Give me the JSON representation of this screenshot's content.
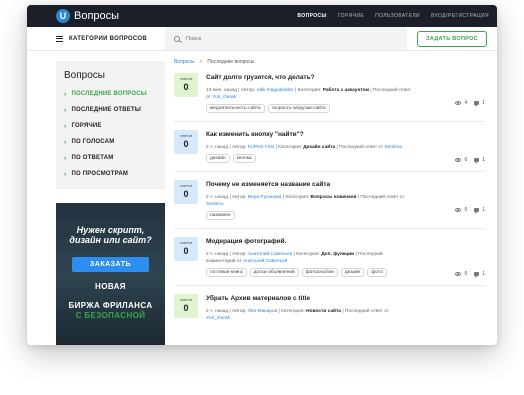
{
  "site": {
    "logo_letter": "U",
    "title": "Вопросы"
  },
  "topnav": [
    "ВОПРОСЫ",
    "ГОРЯЧИЕ",
    "ПОЛЬЗОВАТЕЛИ",
    "ВХОД/РЕГИСТРАЦИЯ"
  ],
  "subbar": {
    "categories_label": "КАТЕГОРИИ ВОПРОСОВ",
    "search_placeholder": "Поиск",
    "ask_button": "ЗАДАТЬ ВОПРОС"
  },
  "sidebar": {
    "title": "Вопросы",
    "items": [
      "ПОСЛЕДНИЕ ВОПРОСЫ",
      "ПОСЛЕДНИЕ ОТВЕТЫ",
      "ГОРЯЧИЕ",
      "ПО ГОЛОСАМ",
      "ПО ОТВЕТАМ",
      "ПО ПРОСМОТРАМ"
    ]
  },
  "ad": {
    "line1": "Нужен скрипт,",
    "line1b": "дизайн или сайт?",
    "button": "ЗАКАЗАТЬ",
    "line2": "НОВАЯ",
    "line2b": "БИРЖА ФРИЛАНСА",
    "line3": "С БЕЗОПАСНОЙ"
  },
  "breadcrumb": {
    "home": "Вопросы",
    "separator": ">",
    "current": "Последние вопросы"
  },
  "answers_caption": "ответов",
  "questions": [
    {
      "answers": "0",
      "title": "Сайт долго грузится, что делать?",
      "meta": {
        "time": "13 мин. назад",
        "author_label": "Автор:",
        "author": "rakli magiakeldze",
        "category_label": "Категория:",
        "category": "Работа с аккаунтом",
        "last_label": "Последний ответ от",
        "last_user": "Yuri_Gerak"
      },
      "tags": [
        "медлительность-сайта",
        "скорость-загрузки-сайта"
      ],
      "views": "4",
      "comments": "1"
    },
    {
      "answers": "0",
      "title": "Как изменить кнопку \"найти\"?",
      "meta": {
        "time": "2 ч. назад",
        "author_label": "Автор:",
        "author": "KriPton First",
        "category_label": "Категория:",
        "category": "Дизайн сайта",
        "last_label": "Последний ответ от",
        "last_user": "Sentimo"
      },
      "tags": [
        "дизайн",
        "кнопка"
      ],
      "views": "6",
      "comments": "1"
    },
    {
      "answers": "0",
      "title": "Почему не изменяется название сайта",
      "meta": {
        "time": "2 ч. назад",
        "author_label": "Автор:",
        "author": "Вера Русанова",
        "category_label": "Категория:",
        "category": "Вопросы новичков",
        "last_label": "Последний ответ от",
        "last_user": "Sentimo"
      },
      "tags": [
        "название"
      ],
      "views": "5",
      "comments": "1"
    },
    {
      "answers": "0",
      "title": "Модерация фотографий.",
      "meta": {
        "time": "2 ч. назад",
        "author_label": "Автор:",
        "author": "Анатолий Савельев",
        "category_label": "Категория:",
        "category": "Доп. функции",
        "last_label": "Последний комментарий от",
        "last_user": "Анатолий Савельев"
      },
      "tags": [
        "гостевая-книга",
        "доска-объявлений",
        "фотоальбом",
        "дизайн",
        "фото"
      ],
      "views": "5",
      "comments": "1"
    },
    {
      "answers": "0",
      "title": "Убрать Архив материалов с title",
      "meta": {
        "time": "2 ч. назад",
        "author_label": "Автор:",
        "author": "Лео Макаров",
        "category_label": "Категория:",
        "category": "Новости сайта",
        "last_label": "Последний ответ от",
        "last_user": "Yuri_Gerak"
      },
      "tags": [],
      "views": "",
      "comments": ""
    }
  ],
  "colors": {
    "accent_green": "#3aa648",
    "link_blue": "#2a86d6",
    "topbar": "#1b1f2a"
  }
}
